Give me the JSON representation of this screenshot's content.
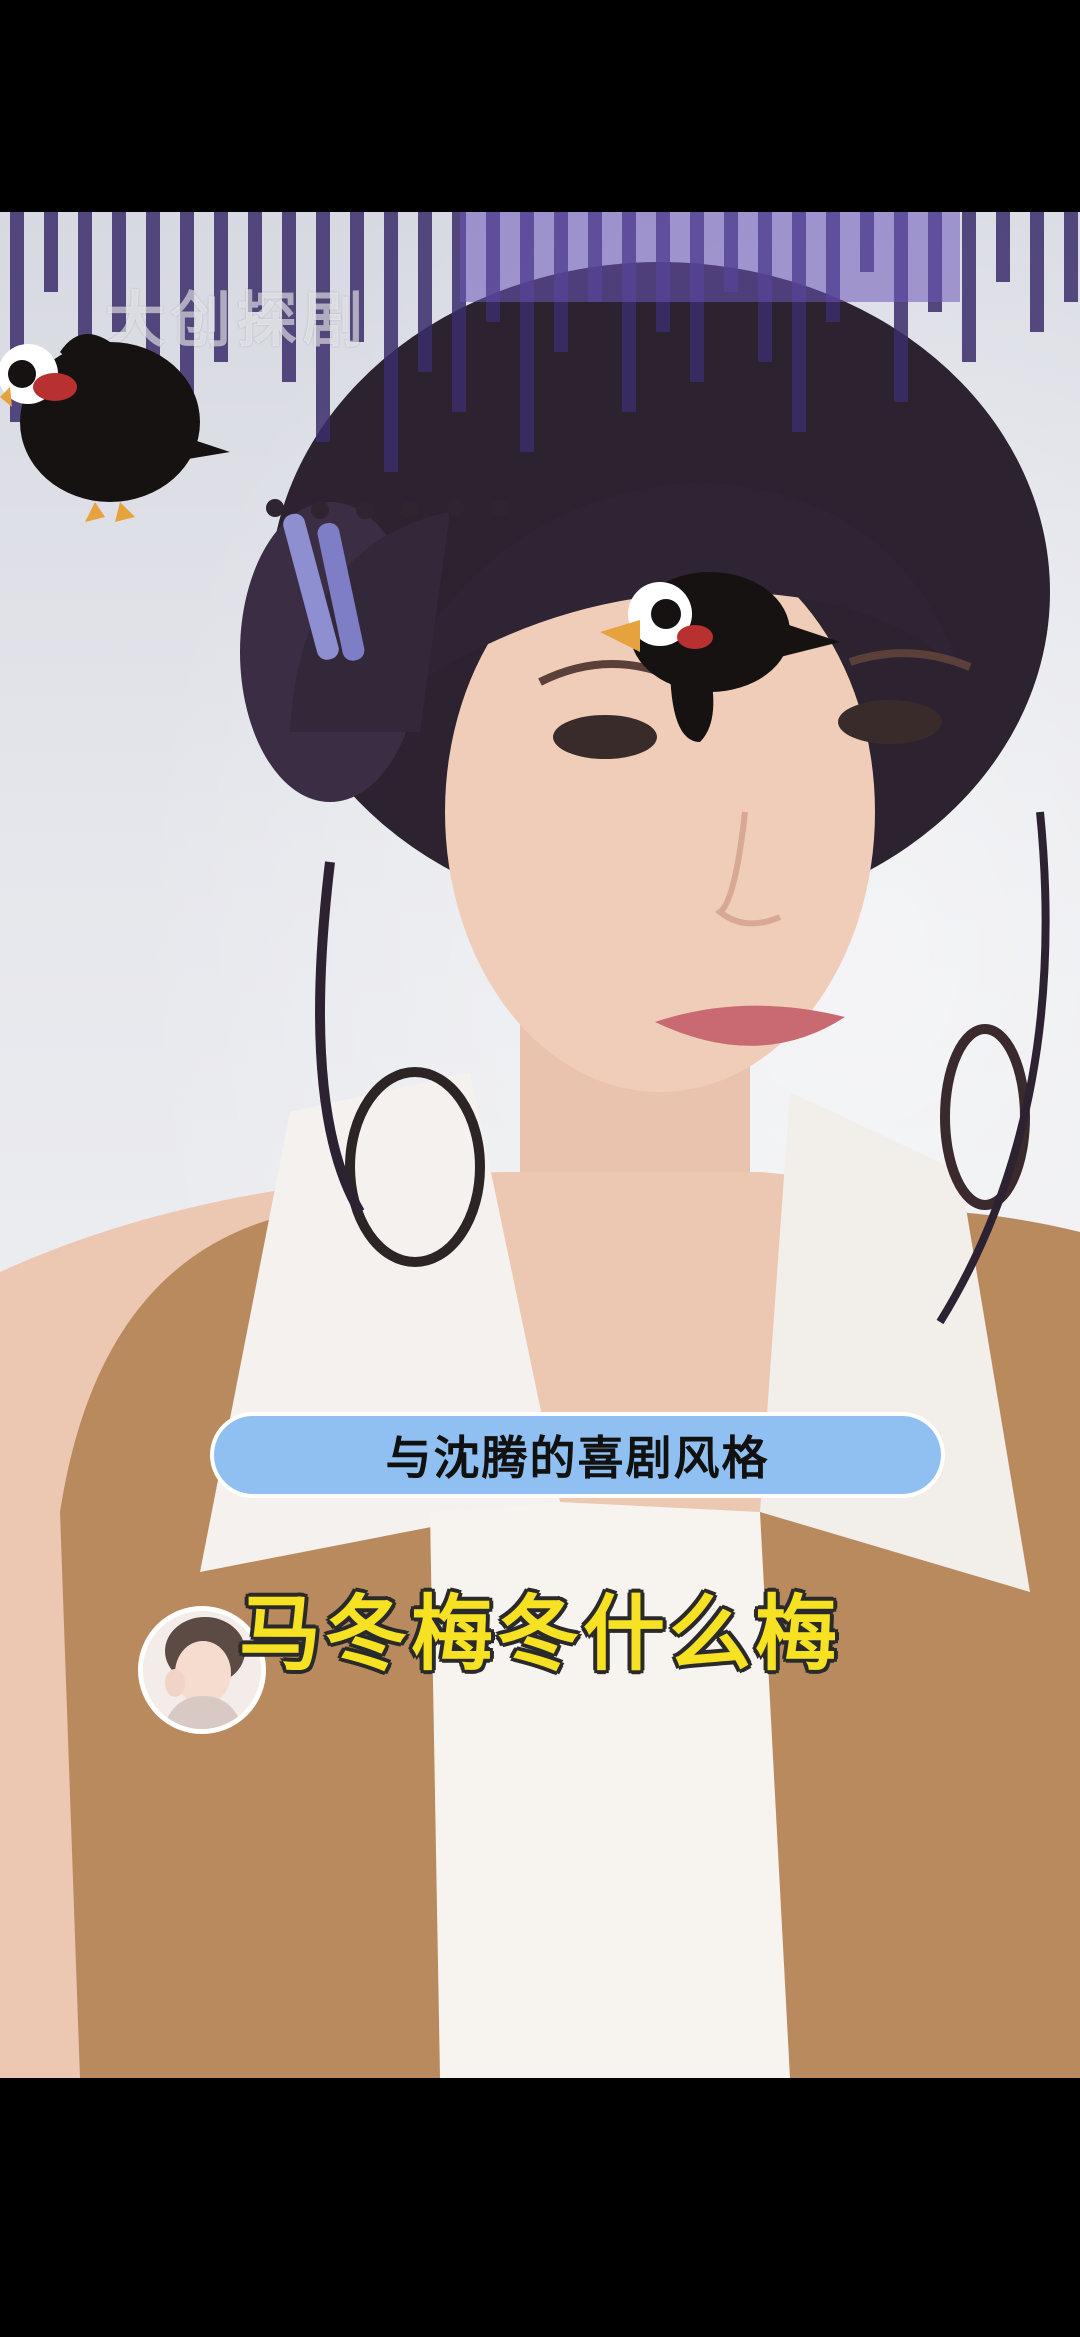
{
  "video": {
    "watermark": "大创探剧",
    "caption_pill": "与沈腾的喜剧风格",
    "subtitle": "马冬梅冬什么梅"
  },
  "icons": {
    "left_bird": "black-bird-sticker-icon",
    "face_bird": "black-bird-sticker-icon",
    "avatar": "avatar"
  },
  "colors": {
    "subtitle_fill": "#f6e222",
    "pill_background": "#8fc0f1",
    "bars": "#3b2d6b"
  }
}
